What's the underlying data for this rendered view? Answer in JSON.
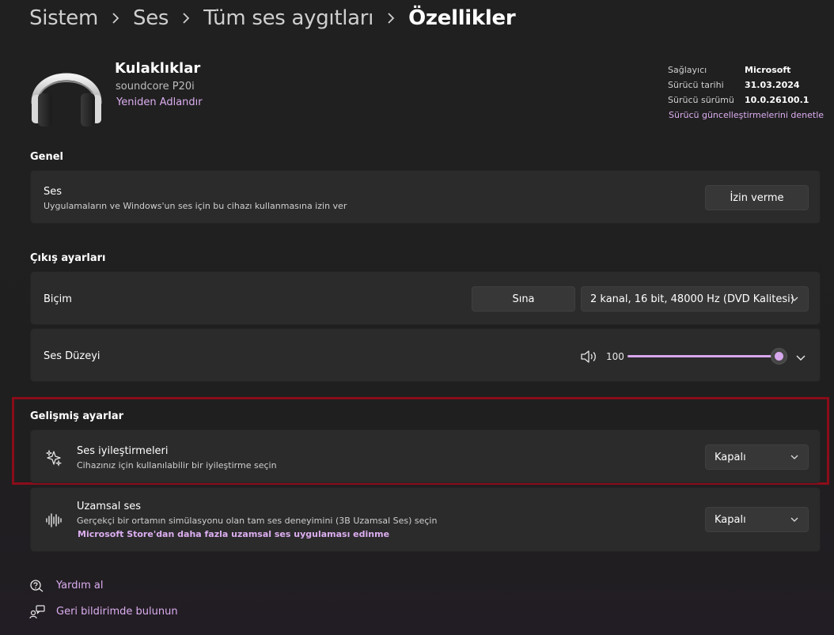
{
  "breadcrumb": {
    "items": [
      "Sistem",
      "Ses",
      "Tüm ses aygıtları",
      "Özellikler"
    ]
  },
  "device": {
    "name": "Kulaklıklar",
    "model": "soundcore P20i",
    "rename_label": "Yeniden Adlandır",
    "icon": "headphones-icon"
  },
  "driver_info": {
    "provider_label": "Sağlayıcı",
    "provider_value": "Microsoft",
    "date_label": "Sürücü tarihi",
    "date_value": "31.03.2024",
    "version_label": "Sürücü sürümü",
    "version_value": "10.0.26100.1",
    "update_link": "Sürücü güncelleştirmelerini denetle"
  },
  "general": {
    "title": "Genel",
    "audio_title": "Ses",
    "audio_desc": "Uygulamaların ve Windows'un ses için bu cihazı kullanmasına izin ver",
    "disallow_button": "İzin verme"
  },
  "output": {
    "title": "Çıkış ayarları",
    "format_label": "Biçim",
    "test_button": "Sına",
    "format_value": "2 kanal, 16 bit, 48000 Hz (DVD Kalitesi)",
    "volume_label": "Ses Düzeyi",
    "volume_value": "100",
    "volume_level": 1.0
  },
  "advanced": {
    "title": "Gelişmiş ayarlar",
    "enhancements_title": "Ses iyileştirmeleri",
    "enhancements_desc": "Cihazınız için kullanılabilir bir iyileştirme seçin",
    "enhancements_value": "Kapalı",
    "spatial_title": "Uzamsal ses",
    "spatial_desc": "Gerçekçi bir ortamın simülasyonu olan tam ses deneyimini (3B Uzamsal Ses) seçin",
    "spatial_store_link": "Microsoft Store'dan daha fazla uzamsal ses uygulaması edinme",
    "spatial_value": "Kapalı"
  },
  "footer": {
    "help_label": "Yardım al",
    "feedback_label": "Geri bildirimde bulunun"
  },
  "colors": {
    "accent": "#dcaef0",
    "highlight_border": "#8b0c1a",
    "card_bg": "#2b2b2b"
  }
}
